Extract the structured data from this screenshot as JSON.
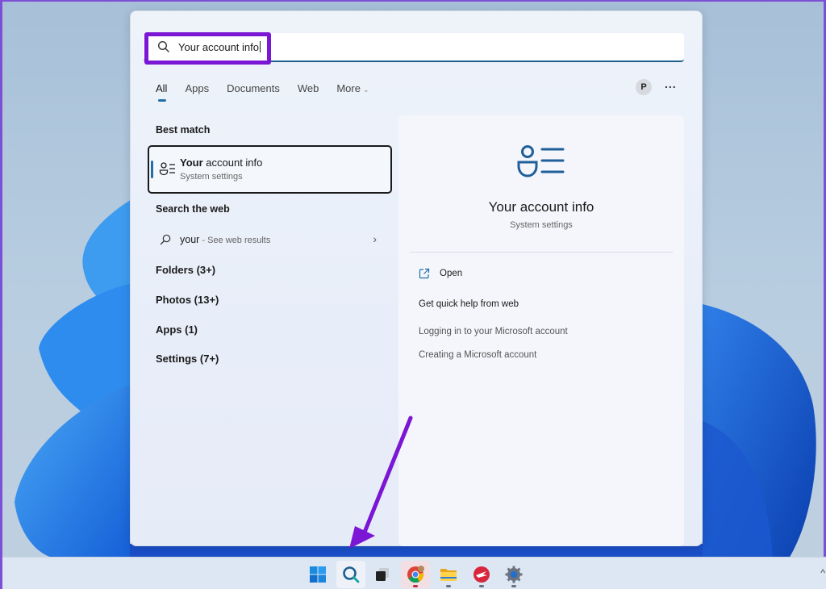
{
  "search": {
    "query": "Your account info"
  },
  "tabs": [
    {
      "label": "All",
      "active": true
    },
    {
      "label": "Apps"
    },
    {
      "label": "Documents"
    },
    {
      "label": "Web"
    },
    {
      "label": "More"
    }
  ],
  "account": {
    "avatar_initial": "P"
  },
  "more_options_label": "...",
  "best_match": {
    "section_label": "Best match",
    "title_bold": "Your",
    "title_rest": " account info",
    "subtitle": "System settings",
    "icon": "account-info-icon"
  },
  "web": {
    "section_label": "Search the web",
    "query": "your",
    "suffix": " - See web results"
  },
  "categories": [
    {
      "label": "Folders (3+)"
    },
    {
      "label": "Photos (13+)"
    },
    {
      "label": "Apps (1)"
    },
    {
      "label": "Settings (7+)"
    }
  ],
  "preview": {
    "title": "Your account info",
    "subtitle": "System settings",
    "open_label": "Open",
    "help_heading": "Get quick help from web",
    "help_links": [
      "Logging in to your Microsoft account",
      "Creating a Microsoft account"
    ]
  },
  "taskbar": {
    "items": [
      {
        "name": "start",
        "icon": "windows-logo-icon"
      },
      {
        "name": "search",
        "icon": "search-icon",
        "active": true
      },
      {
        "name": "task-view",
        "icon": "task-view-icon"
      },
      {
        "name": "chrome",
        "icon": "chrome-icon",
        "running": true
      },
      {
        "name": "file-explorer",
        "icon": "folder-icon",
        "running": true
      },
      {
        "name": "app",
        "icon": "red-app-icon",
        "running": true
      },
      {
        "name": "settings",
        "icon": "gear-icon",
        "running": true
      }
    ],
    "tray_chevron": "^"
  },
  "colors": {
    "highlight": "#7a16d4",
    "accent": "#1f6fa8",
    "annotation_arrow": "#7a16d4"
  }
}
